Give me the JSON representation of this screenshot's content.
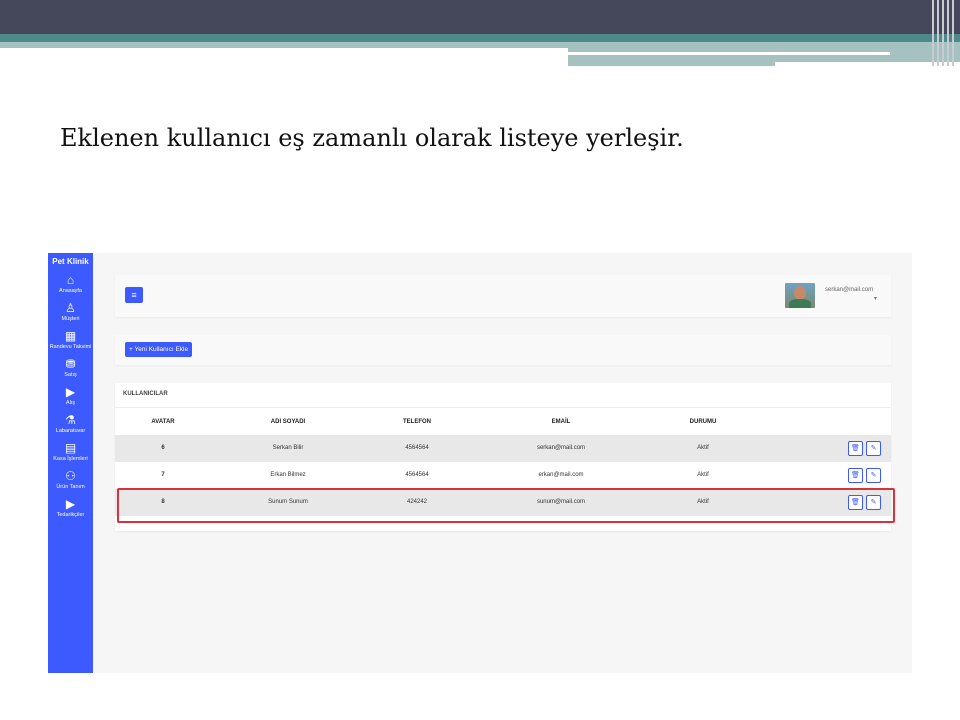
{
  "slide": {
    "title": "Eklenen kullanıcı eş zamanlı olarak listeye yerleşir."
  },
  "app": {
    "brand": "Pet Klinik",
    "accent_color": "#3d5afe",
    "highlight_color": "#d8323a",
    "sidebar": {
      "items": [
        {
          "icon": "home-icon",
          "glyph": "⌂",
          "label": "Anasayfa"
        },
        {
          "icon": "user-icon",
          "glyph": "♙",
          "label": "Müşteri"
        },
        {
          "icon": "calendar-icon",
          "glyph": "▦",
          "label": "Randevu Takvimi"
        },
        {
          "icon": "basket-icon",
          "glyph": "⛃",
          "label": "Satış"
        },
        {
          "icon": "truck-icon",
          "glyph": "▶",
          "label": "Alış"
        },
        {
          "icon": "flask-icon",
          "glyph": "⚗",
          "label": "Labaratuvar"
        },
        {
          "icon": "card-icon",
          "glyph": "▤",
          "label": "Kasa İşlemleri"
        },
        {
          "icon": "people-icon",
          "glyph": "⚇",
          "label": "Ürün Tanım"
        },
        {
          "icon": "truck-icon",
          "glyph": "▶",
          "label": "Tedarikçiler"
        }
      ]
    },
    "topbar": {
      "menu_glyph": "≡",
      "user_email": "serkan@mail.com",
      "caret": "▾"
    },
    "actions": {
      "add_user_label": "+ Yeni Kullanıcı Ekle"
    },
    "users_card": {
      "title": "KULLANICILAR",
      "columns": [
        "AVATAR",
        "ADI SOYADI",
        "TELEFON",
        "EMAİL",
        "DURUMU"
      ],
      "rows": [
        {
          "avatar": "6",
          "name": "Serkan Bilir",
          "phone": "4564564",
          "email": "serkan@mail.com",
          "status": "Aktif"
        },
        {
          "avatar": "7",
          "name": "Erkan Bilmez",
          "phone": "4564564",
          "email": "erkan@mail.com",
          "status": "Aktif"
        },
        {
          "avatar": "8",
          "name": "Sunum Sunum",
          "phone": "424242",
          "email": "sunum@mail.com",
          "status": "Aktif"
        }
      ],
      "delete_glyph": "🗑",
      "edit_glyph": "✎"
    }
  }
}
